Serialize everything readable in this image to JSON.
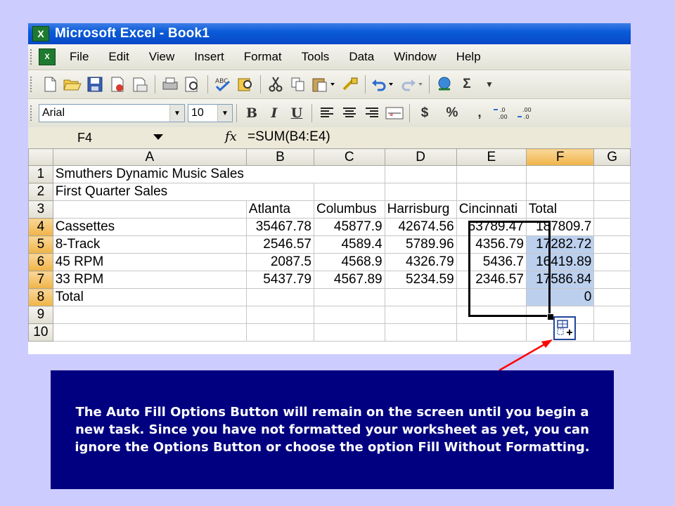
{
  "window": {
    "title": "Microsoft Excel - Book1"
  },
  "menu": [
    "File",
    "Edit",
    "View",
    "Insert",
    "Format",
    "Tools",
    "Data",
    "Window",
    "Help"
  ],
  "format_toolbar": {
    "font": "Arial",
    "size": "10",
    "bold": "B",
    "italic": "I",
    "underline": "U",
    "currency": "$",
    "percent": "%",
    "comma": ","
  },
  "formula_bar": {
    "name_box": "F4",
    "fx": "fx",
    "formula": "=SUM(B4:E4)"
  },
  "columns": [
    "A",
    "B",
    "C",
    "D",
    "E",
    "F",
    "G"
  ],
  "rows": [
    {
      "num": "1",
      "cells": [
        "Smuthers Dynamic Music Sales",
        "",
        "",
        "",
        "",
        "",
        ""
      ]
    },
    {
      "num": "2",
      "cells": [
        "First Quarter Sales",
        "",
        "",
        "",
        "",
        "",
        ""
      ]
    },
    {
      "num": "3",
      "cells": [
        "",
        "Atlanta",
        "Columbus",
        "Harrisburg",
        "Cincinnati",
        "Total",
        ""
      ]
    },
    {
      "num": "4",
      "cells": [
        "Cassettes",
        "35467.78",
        "45877.9",
        "42674.56",
        "63789.47",
        "187809.7",
        ""
      ]
    },
    {
      "num": "5",
      "cells": [
        "8-Track",
        "2546.57",
        "4589.4",
        "5789.96",
        "4356.79",
        "17282.72",
        ""
      ]
    },
    {
      "num": "6",
      "cells": [
        "45 RPM",
        "2087.5",
        "4568.9",
        "4326.79",
        "5436.7",
        "16419.89",
        ""
      ]
    },
    {
      "num": "7",
      "cells": [
        "33 RPM",
        "5437.79",
        "4567.89",
        "5234.59",
        "2346.57",
        "17586.84",
        ""
      ]
    },
    {
      "num": "8",
      "cells": [
        "Total",
        "",
        "",
        "",
        "",
        "0",
        ""
      ]
    },
    {
      "num": "9",
      "cells": [
        "",
        "",
        "",
        "",
        "",
        "",
        ""
      ]
    },
    {
      "num": "10",
      "cells": [
        "",
        "",
        "",
        "",
        "",
        "",
        ""
      ]
    }
  ],
  "selection": {
    "active_cell": "F4",
    "range": "F4:F8"
  },
  "caption": "The Auto Fill Options Button will remain on the screen until you begin a new task.  Since you have not formatted your worksheet as yet, you can ignore the Options Button or choose the option Fill Without Formatting.",
  "colors": {
    "title_bar": "#0a5bd8",
    "background": "#ccccff",
    "panel": "#000080",
    "selected_header": "#f0b447",
    "selection_fill": "#bcd0ee",
    "pointer": "#ff0000"
  },
  "icons": [
    "excel-icon",
    "new-icon",
    "open-icon",
    "save-icon",
    "permission-icon",
    "email-icon",
    "print-icon",
    "print-preview-icon",
    "spelling-icon",
    "research-icon",
    "cut-icon",
    "copy-icon",
    "paste-icon",
    "format-painter-icon",
    "undo-icon",
    "redo-icon",
    "hyperlink-icon",
    "autosum-icon",
    "auto-fill-options-icon"
  ]
}
